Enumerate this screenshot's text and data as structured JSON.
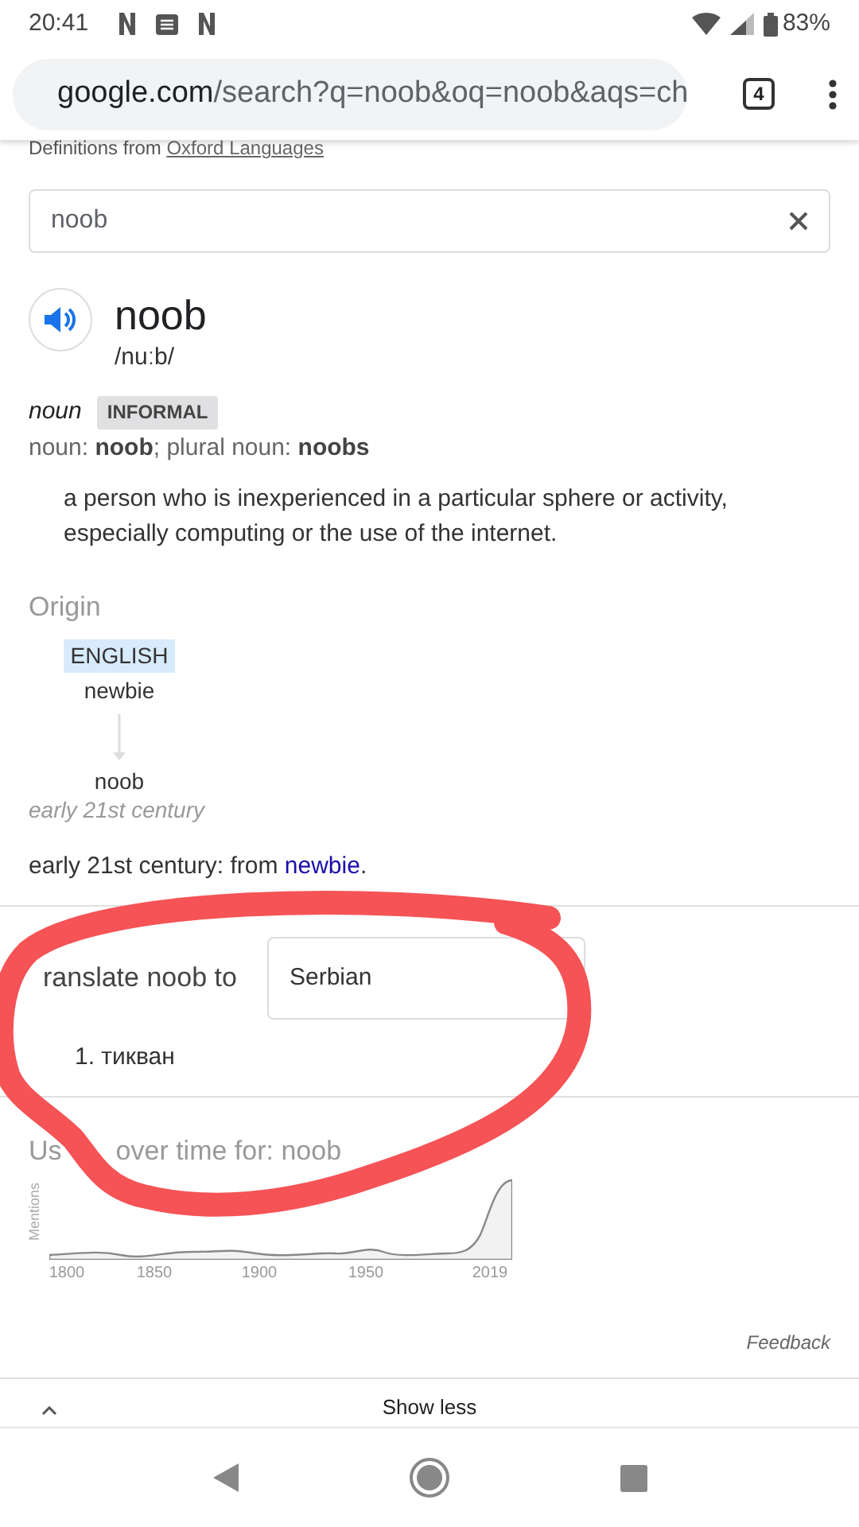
{
  "status_bar": {
    "time": "20:41",
    "battery": "83%"
  },
  "browser": {
    "url_domain": "google.com",
    "url_path": "/search?q=noob&oq=noob&aqs=ch",
    "tab_count": "4"
  },
  "source": {
    "prefix": "Definitions from",
    "link": "Oxford Languages"
  },
  "search": {
    "value": "noob"
  },
  "entry": {
    "word": "noob",
    "pronunciation": "/nuːb/",
    "part_of_speech": "noun",
    "register": "INFORMAL",
    "forms": "noun: **noob**; plural noun: **noobs**",
    "definition": "a person who is inexperienced in a particular sphere or activity, especially computing or the use of the internet."
  },
  "origin": {
    "heading": "Origin",
    "language": "ENGLISH",
    "source_word": "newbie",
    "target_word": "noob",
    "date": "early 21st century",
    "etymology_text": "early 21st century: from ",
    "etymology_link": "newbie",
    "etymology_end": "."
  },
  "translate": {
    "label": "ranslate noob to",
    "language": "Serbian",
    "results": [
      "1. тикван"
    ]
  },
  "usage": {
    "title_start": "Us",
    "title_end": "over time for: noob",
    "ylabel": "Mentions",
    "x_ticks": [
      "1800",
      "1850",
      "1900",
      "1950",
      "2019"
    ]
  },
  "feedback": "Feedback",
  "show_less": "Show less"
}
